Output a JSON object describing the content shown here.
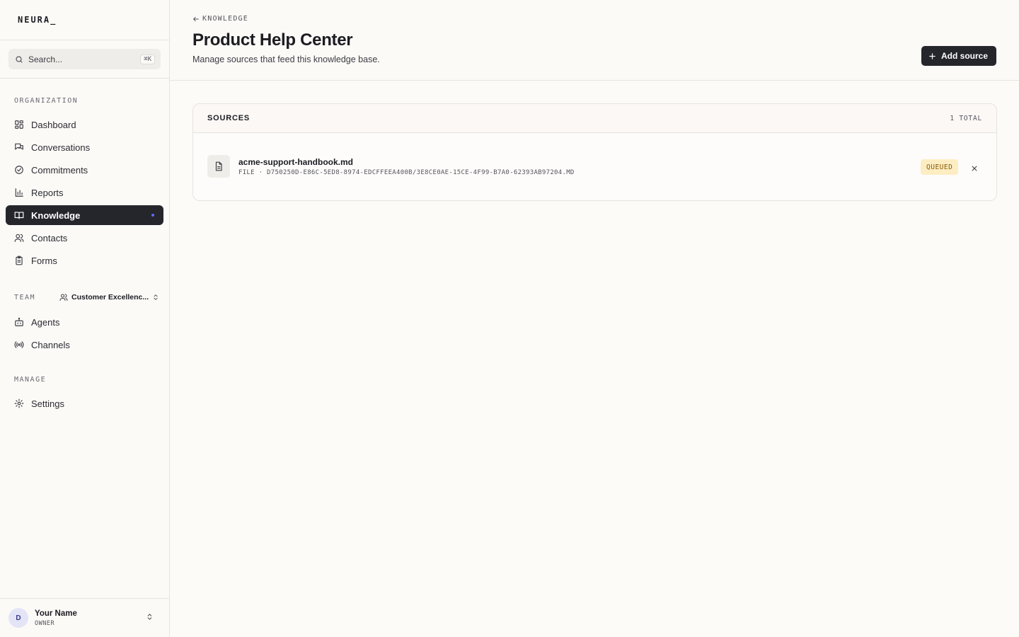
{
  "brand": {
    "name": "NEURA_"
  },
  "search": {
    "placeholder": "Search...",
    "shortcut": "⌘K"
  },
  "sidebar": {
    "organization_label": "ORGANIZATION",
    "org_items": [
      {
        "label": "Dashboard",
        "icon": "dashboard-icon"
      },
      {
        "label": "Conversations",
        "icon": "conversations-icon"
      },
      {
        "label": "Commitments",
        "icon": "check-circle-icon"
      },
      {
        "label": "Reports",
        "icon": "bar-chart-icon"
      },
      {
        "label": "Knowledge",
        "icon": "book-icon",
        "active": true
      },
      {
        "label": "Contacts",
        "icon": "users-icon"
      },
      {
        "label": "Forms",
        "icon": "clipboard-icon"
      }
    ],
    "team_label": "TEAM",
    "team_selector": "Customer Excellenc...",
    "team_items": [
      {
        "label": "Agents",
        "icon": "bot-icon"
      },
      {
        "label": "Channels",
        "icon": "radio-icon"
      }
    ],
    "manage_label": "MANAGE",
    "manage_items": [
      {
        "label": "Settings",
        "icon": "gear-icon"
      }
    ]
  },
  "user": {
    "initial": "D",
    "name": "Your Name",
    "role": "OWNER"
  },
  "header": {
    "breadcrumb": "KNOWLEDGE",
    "title": "Product Help Center",
    "subtitle": "Manage sources that feed this knowledge base.",
    "add_button": "Add source"
  },
  "sources": {
    "title": "SOURCES",
    "count": "1 TOTAL",
    "items": [
      {
        "name": "acme-support-handbook.md",
        "meta": "FILE · D750250D-E86C-5ED8-8974-EDCFFEEA400B/3E8CE0AE-15CE-4F99-B7A0-62393AB97204.MD",
        "status": "QUEUED"
      }
    ]
  },
  "colors": {
    "accent_dark": "#25252c",
    "active_dot": "#5b6cff",
    "queued_bg": "#fdedc2",
    "queued_text": "#8a5a08"
  }
}
